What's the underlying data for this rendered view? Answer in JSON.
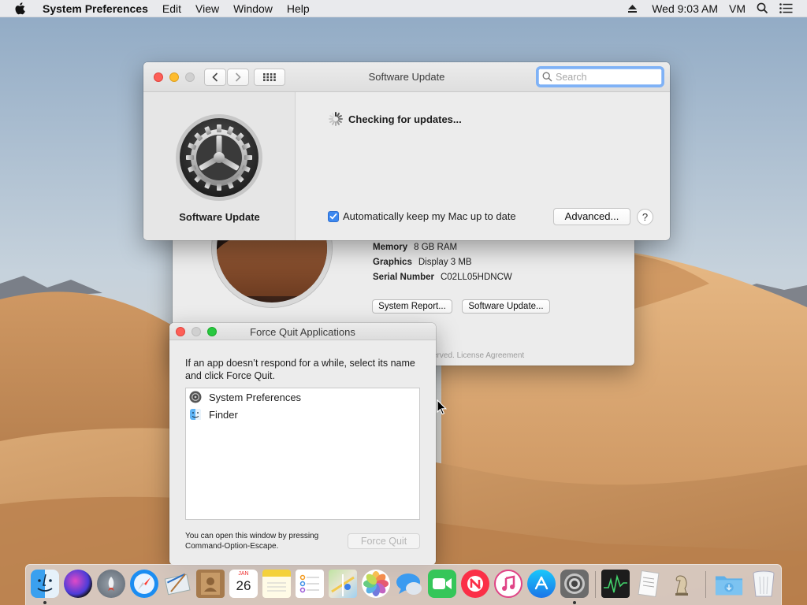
{
  "menubar": {
    "app_name": "System Preferences",
    "menus": [
      "Edit",
      "View",
      "Window",
      "Help"
    ],
    "clock": "Wed 9:03 AM",
    "user": "VM"
  },
  "about_window": {
    "specs": [
      {
        "key": "Memory",
        "value": "8 GB RAM"
      },
      {
        "key": "Graphics",
        "value": "Display 3 MB"
      },
      {
        "key": "Serial Number",
        "value": "C02LL05HDNCW"
      }
    ],
    "buttons": {
      "report": "System Report...",
      "update": "Software Update..."
    },
    "footer": "erved. License Agreement"
  },
  "software_update": {
    "title": "Software Update",
    "search_placeholder": "Search",
    "pane_label": "Software Update",
    "status": "Checking for updates...",
    "auto_update_label": "Automatically keep my Mac up to date",
    "auto_update_checked": true,
    "advanced_label": "Advanced...",
    "help_label": "?"
  },
  "force_quit": {
    "title": "Force Quit Applications",
    "description": "If an app doesn’t respond for a while, select its name and click Force Quit.",
    "apps": [
      {
        "name": "System Preferences",
        "icon": "system-preferences-icon"
      },
      {
        "name": "Finder",
        "icon": "finder-icon"
      }
    ],
    "hint": "You can open this window by pressing Command-Option-Escape.",
    "button_label": "Force Quit"
  },
  "dock": {
    "apps": [
      {
        "name": "Finder",
        "icon": "finder-icon",
        "running": true
      },
      {
        "name": "Siri",
        "icon": "siri-icon",
        "running": false
      },
      {
        "name": "Launchpad",
        "icon": "launchpad-icon",
        "running": false
      },
      {
        "name": "Safari",
        "icon": "safari-icon",
        "running": false
      },
      {
        "name": "Mail",
        "icon": "mail-icon",
        "running": false
      },
      {
        "name": "Contacts",
        "icon": "contacts-icon",
        "running": false
      },
      {
        "name": "Calendar",
        "icon": "calendar-icon",
        "running": false,
        "month": "JAN",
        "day": "26"
      },
      {
        "name": "Notes",
        "icon": "notes-icon",
        "running": false
      },
      {
        "name": "Reminders",
        "icon": "reminders-icon",
        "running": false
      },
      {
        "name": "Maps",
        "icon": "maps-icon",
        "running": false
      },
      {
        "name": "Photos",
        "icon": "photos-icon",
        "running": false
      },
      {
        "name": "Messages",
        "icon": "messages-icon",
        "running": false
      },
      {
        "name": "FaceTime",
        "icon": "facetime-icon",
        "running": false
      },
      {
        "name": "News",
        "icon": "news-icon",
        "running": false
      },
      {
        "name": "iTunes",
        "icon": "itunes-icon",
        "running": false
      },
      {
        "name": "App Store",
        "icon": "app-store-icon",
        "running": false
      },
      {
        "name": "System Preferences",
        "icon": "system-preferences-icon",
        "running": true
      },
      {
        "name": "Activity Monitor",
        "icon": "activity-monitor-icon",
        "running": false
      },
      {
        "name": "TextEdit",
        "icon": "textedit-icon",
        "running": false
      },
      {
        "name": "Chess",
        "icon": "chess-icon",
        "running": false
      },
      {
        "name": "Downloads",
        "icon": "downloads-folder-icon",
        "running": false
      },
      {
        "name": "Trash",
        "icon": "trash-icon",
        "running": false
      }
    ]
  },
  "colors": {
    "accent": "#3c88f0",
    "close": "#fd5f57",
    "minimize": "#febc2e",
    "maximize": "#28c840"
  }
}
